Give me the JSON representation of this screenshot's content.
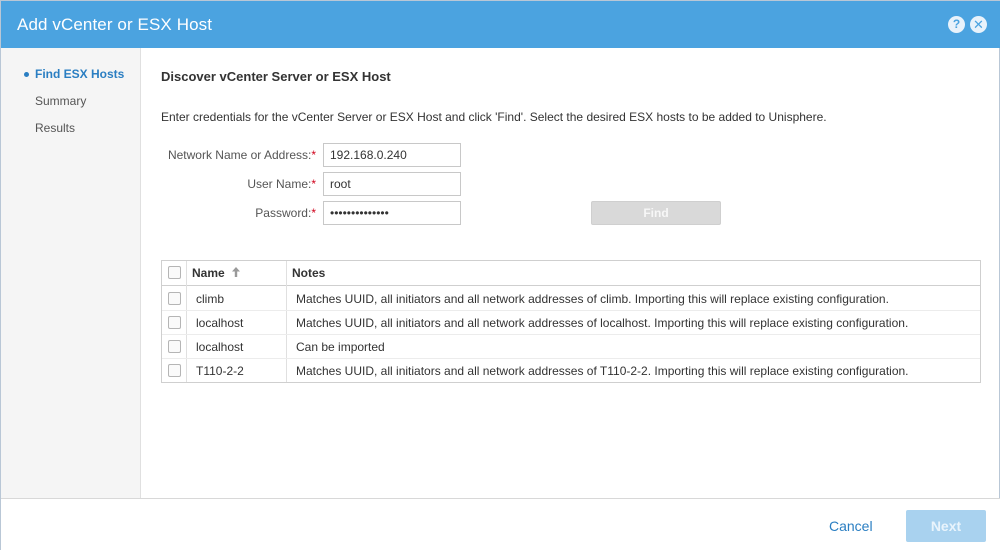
{
  "window": {
    "title": "Add vCenter or ESX Host",
    "help_icon": "?",
    "close_icon": "✕"
  },
  "sidebar": {
    "steps": [
      {
        "label": "Find ESX Hosts",
        "active": true
      },
      {
        "label": "Summary",
        "active": false
      },
      {
        "label": "Results",
        "active": false
      }
    ]
  },
  "main": {
    "heading": "Discover vCenter Server or ESX Host",
    "instructions": "Enter credentials for the vCenter Server or ESX Host and click 'Find'. Select the desired ESX hosts to be added to Unisphere.",
    "form": {
      "network_label": "Network Name or Address:",
      "network_value": "192.168.0.240",
      "user_label": "User Name:",
      "user_value": "root",
      "password_label": "Password:",
      "password_value": "••••••••••••••",
      "required_marker": "*",
      "find_label": "Find"
    },
    "table": {
      "columns": [
        "Name",
        "Notes"
      ],
      "sort_icon": "arrow-up-icon",
      "rows": [
        {
          "name": "climb",
          "notes": "Matches UUID, all initiators and all network addresses of climb. Importing this will replace existing configuration."
        },
        {
          "name": "localhost",
          "notes": "Matches UUID, all initiators and all network addresses of localhost. Importing this will replace existing configuration."
        },
        {
          "name": "localhost",
          "notes": "Can be imported"
        },
        {
          "name": "T110-2-2",
          "notes": "Matches UUID, all initiators and all network addresses of T110-2-2. Importing this will replace existing configuration."
        }
      ]
    }
  },
  "footer": {
    "cancel_label": "Cancel",
    "next_label": "Next"
  },
  "colors": {
    "titlebar": "#4ba3e0",
    "accent": "#2a7ec2",
    "required": "#d0021b"
  }
}
